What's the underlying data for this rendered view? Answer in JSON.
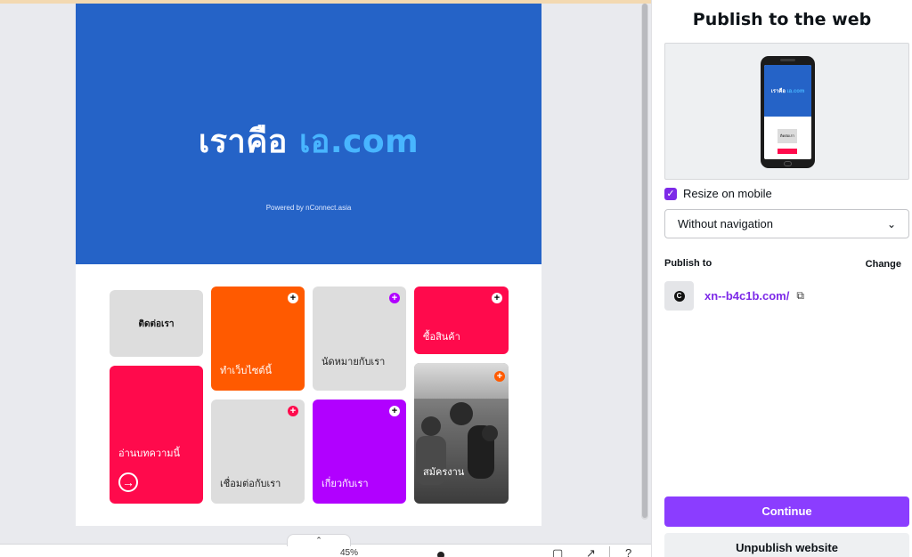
{
  "canvas": {
    "hero_title_main": "เราคือ ",
    "hero_title_accent": "เอ.com",
    "hero_subtitle": "Powered by nConnect.asia",
    "tiles": {
      "contact": "ติดต่อเรา",
      "make_website": "ทำเว็บไซต์นี้",
      "appointment": "นัดหมายกับเรา",
      "buy_products": "ซื้อสินค้า",
      "read_article": "อ่านบทความนี้",
      "connect": "เชื่อมต่อกับเรา",
      "about": "เกี่ยวกับเรา",
      "apply_job": "สมัครงาน"
    },
    "colors": {
      "hero_blue": "#2563c7",
      "accent_blue": "#48b5ff",
      "orange": "#ff5a00",
      "red": "#ff0a4c",
      "purple": "#b100ff",
      "grey": "#dddddd"
    }
  },
  "bottom_bar": {
    "zoom": "45%"
  },
  "panel": {
    "title": "Publish to the web",
    "preview_mini_title_main": "เราคือ ",
    "preview_mini_title_accent": "เอ.com",
    "preview_mini_button": "ติดต่อเรา",
    "resize_on_mobile_label": "Resize on mobile",
    "resize_on_mobile_checked": true,
    "navigation_select": "Without navigation",
    "publish_to_label": "Publish to",
    "change_label": "Change",
    "domain": "xn--b4c1b.com/",
    "domain_avatar": "C",
    "continue_label": "Continue",
    "unpublish_label": "Unpublish website",
    "brand_purple": "#8b3dff"
  }
}
